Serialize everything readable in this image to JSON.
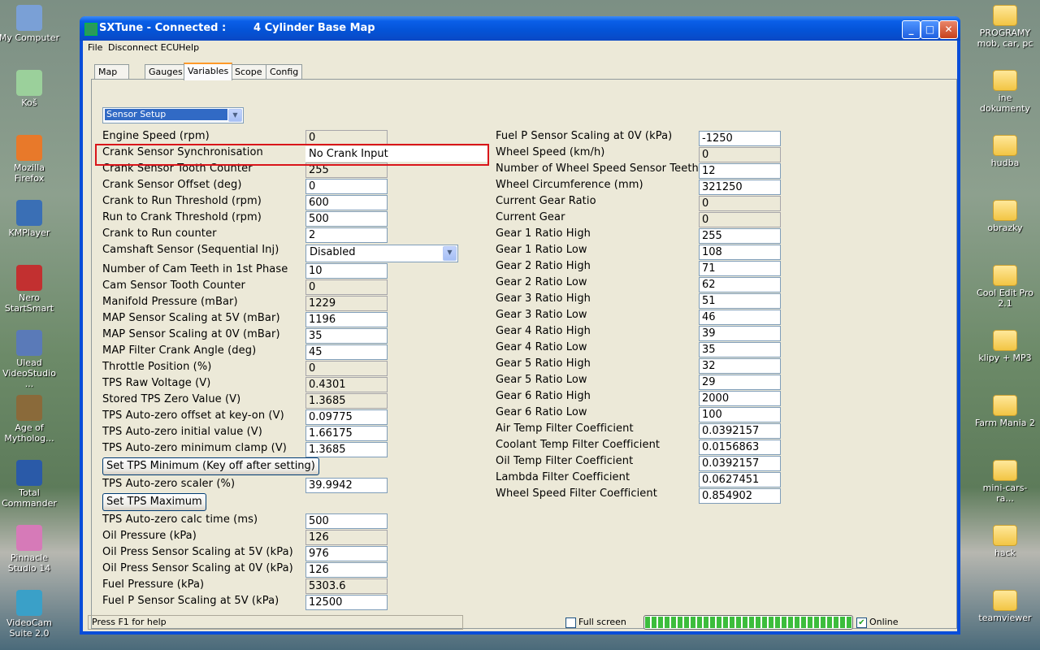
{
  "desktop": {
    "left_icons": [
      "My Computer",
      "Koš",
      "Mozilla Firefox",
      "KMPlayer",
      "Nero StartSmart",
      "Ulead VideoStudio ...",
      "Age of Mytholog...",
      "Total Commander",
      "Pinnacle Studio 14",
      "VideoCam Suite 2.0"
    ],
    "right_icons": [
      "PROGRAMY mob, car, pc",
      "ine dokumenty",
      "hudba",
      "obrazky",
      "Cool Edit Pro 2.1",
      "klipy + MP3",
      "Farm Mania 2",
      "mini-cars-ra...",
      "hack",
      "teamviewer"
    ]
  },
  "window": {
    "title": "SXTune - Connected :",
    "map_name": "4 Cylinder Base Map",
    "controls": {
      "minimize": "_",
      "maximize": "□",
      "close": "✕"
    }
  },
  "menu": [
    "File",
    "Disconnect ECU",
    "Help"
  ],
  "tabs": [
    "Map Editor",
    "Gauges",
    "Variables",
    "Scope",
    "Config"
  ],
  "active_tab": "Variables",
  "category_select": "Sensor Setup",
  "left_rows": [
    {
      "label": "Engine Speed (rpm)",
      "value": "0",
      "ro": true
    },
    {
      "label": "Crank Sensor Synchronisation",
      "value": "No Crank Input",
      "ro": false
    },
    {
      "label": "Crank Sensor Tooth Counter",
      "value": "255",
      "ro": true
    },
    {
      "label": "Crank Sensor Offset (deg)",
      "value": "0",
      "ro": false
    },
    {
      "label": "Crank to Run Threshold (rpm)",
      "value": "600",
      "ro": false
    },
    {
      "label": "Run to Crank Threshold (rpm)",
      "value": "500",
      "ro": false
    },
    {
      "label": "Crank to Run counter",
      "value": "2",
      "ro": false
    },
    {
      "label": "Camshaft Sensor (Sequential Inj)",
      "value": "Disabled",
      "ro": false
    },
    {
      "label": "Number of Cam Teeth in 1st Phase",
      "value": "10",
      "ro": false
    },
    {
      "label": "Cam Sensor Tooth Counter",
      "value": "0",
      "ro": true
    },
    {
      "label": "Manifold Pressure (mBar)",
      "value": "1229",
      "ro": true
    },
    {
      "label": "MAP Sensor Scaling at 5V (mBar)",
      "value": "1196",
      "ro": false
    },
    {
      "label": "MAP Sensor Scaling at 0V (mBar)",
      "value": "35",
      "ro": false
    },
    {
      "label": "MAP Filter Crank Angle (deg)",
      "value": "45",
      "ro": false
    },
    {
      "label": "Throttle Position (%)",
      "value": "0",
      "ro": true
    },
    {
      "label": "TPS Raw Voltage (V)",
      "value": "0.4301",
      "ro": true
    },
    {
      "label": "Stored TPS Zero Value (V)",
      "value": "1.3685",
      "ro": true
    },
    {
      "label": "TPS Auto-zero offset at key-on (V)",
      "value": "0.09775",
      "ro": false
    },
    {
      "label": "TPS Auto-zero initial value (V)",
      "value": "1.66175",
      "ro": false
    },
    {
      "label": "TPS Auto-zero minimum clamp (V)",
      "value": "1.3685",
      "ro": false
    },
    {
      "label": "Set TPS Minimum (Key off after setting)",
      "button": true
    },
    {
      "label": "TPS Auto-zero scaler (%)",
      "value": "39.9942",
      "ro": false
    },
    {
      "label": "Set TPS Maximum",
      "button": true
    },
    {
      "label": "TPS Auto-zero calc time (ms)",
      "value": "500",
      "ro": false
    },
    {
      "label": "Oil Pressure (kPa)",
      "value": "126",
      "ro": true
    },
    {
      "label": "Oil Press Sensor Scaling at 5V (kPa)",
      "value": "976",
      "ro": false
    },
    {
      "label": "Oil Press Sensor Scaling at 0V (kPa)",
      "value": "126",
      "ro": false
    },
    {
      "label": "Fuel Pressure (kPa)",
      "value": "5303.6",
      "ro": true
    },
    {
      "label": "Fuel P Sensor Scaling at 5V (kPa)",
      "value": "12500",
      "ro": false
    }
  ],
  "right_rows": [
    {
      "label": "Fuel P Sensor Scaling at 0V (kPa)",
      "value": "-1250",
      "ro": false
    },
    {
      "label": "Wheel Speed (km/h)",
      "value": "0",
      "ro": true
    },
    {
      "label": "Number of Wheel Speed Sensor Teeth",
      "value": "12",
      "ro": false
    },
    {
      "label": "Wheel Circumference (mm)",
      "value": "321250",
      "ro": false
    },
    {
      "label": "Current Gear Ratio",
      "value": "0",
      "ro": true
    },
    {
      "label": "Current Gear",
      "value": "0",
      "ro": true
    },
    {
      "label": "Gear 1 Ratio High",
      "value": "255",
      "ro": false
    },
    {
      "label": "Gear 1 Ratio Low",
      "value": "108",
      "ro": false
    },
    {
      "label": "Gear 2 Ratio High",
      "value": "71",
      "ro": false
    },
    {
      "label": "Gear 2 Ratio Low",
      "value": "62",
      "ro": false
    },
    {
      "label": "Gear 3 Ratio High",
      "value": "51",
      "ro": false
    },
    {
      "label": "Gear 3 Ratio Low",
      "value": "46",
      "ro": false
    },
    {
      "label": "Gear 4 Ratio High",
      "value": "39",
      "ro": false
    },
    {
      "label": "Gear 4 Ratio Low",
      "value": "35",
      "ro": false
    },
    {
      "label": "Gear 5 Ratio High",
      "value": "32",
      "ro": false
    },
    {
      "label": "Gear 5 Ratio Low",
      "value": "29",
      "ro": false
    },
    {
      "label": "Gear 6 Ratio High",
      "value": "2000",
      "ro": false
    },
    {
      "label": "Gear 6 Ratio Low",
      "value": "100",
      "ro": false
    },
    {
      "label": "Air Temp Filter Coefficient",
      "value": "0.0392157",
      "ro": false
    },
    {
      "label": "Coolant Temp Filter Coefficient",
      "value": "0.0156863",
      "ro": false
    },
    {
      "label": "Oil Temp Filter Coefficient",
      "value": "0.0392157",
      "ro": false
    },
    {
      "label": "Lambda Filter Coefficient",
      "value": "0.0627451",
      "ro": false
    },
    {
      "label": "Wheel Speed Filter Coefficient",
      "value": "0.854902",
      "ro": false
    }
  ],
  "status": {
    "help_text": "Press F1 for help",
    "fullscreen_label": "Full screen",
    "fullscreen_checked": false,
    "online_label": "Online",
    "online_checked": true,
    "progress": 1.0
  },
  "colors": {
    "accent": "#316ac5",
    "highlight": "#d9151a",
    "title_blue": "#0453d6"
  }
}
